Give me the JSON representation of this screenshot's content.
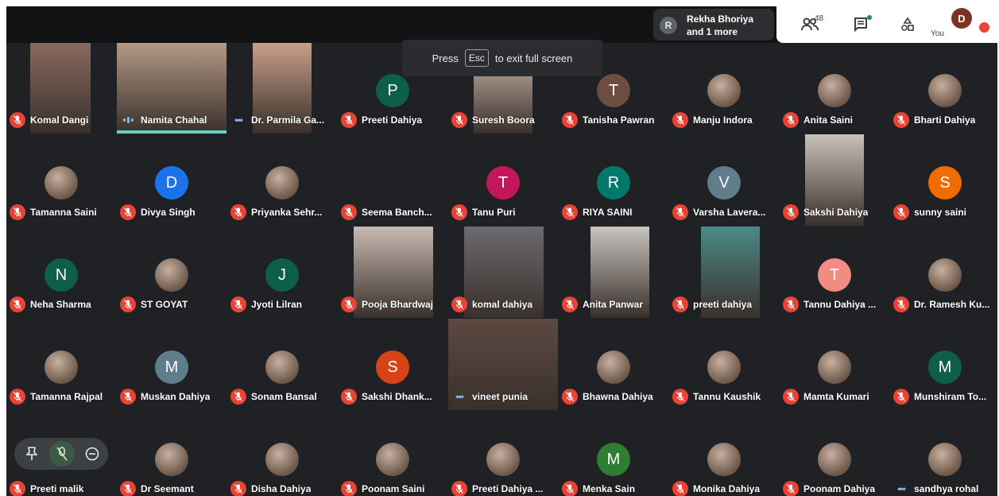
{
  "topbar": {
    "presenter": {
      "initial": "R",
      "line1": "Rekha Bhoriya",
      "line2": "and 1 more"
    },
    "participants_count": "48",
    "you_label": "You",
    "self_initial": "D"
  },
  "toast": {
    "press": "Press",
    "key": "Esc",
    "rest": "to exit full screen"
  },
  "colors": {
    "mute": "#ea4335",
    "speaking": "#66d0c4",
    "talking_icon": "#8ab4f8",
    "tile_bg": "#202124"
  },
  "participants": [
    {
      "name": "Komal Dangi",
      "status": "muted",
      "media": "video"
    },
    {
      "name": "Namita Chahal",
      "status": "talking",
      "media": "video"
    },
    {
      "name": "Dr. Parmila Ga...",
      "status": "dots",
      "media": "video"
    },
    {
      "name": "Preeti Dahiya",
      "status": "muted",
      "media": "avatar",
      "initial": "P",
      "color": "#0d5e4a"
    },
    {
      "name": "Suresh Boora",
      "status": "muted",
      "media": "video"
    },
    {
      "name": "Tanisha Pawran",
      "status": "muted",
      "media": "avatar",
      "initial": "T",
      "color": "#6d4c41"
    },
    {
      "name": "Manju Indora",
      "status": "muted",
      "media": "photo"
    },
    {
      "name": "Anita Saini",
      "status": "muted",
      "media": "photo"
    },
    {
      "name": "Bharti Dahiya",
      "status": "muted",
      "media": "photo"
    },
    {
      "name": "Tamanna Saini",
      "status": "muted",
      "media": "photo"
    },
    {
      "name": "Divya Singh",
      "status": "muted",
      "media": "avatar",
      "initial": "D",
      "color": "#1a73e8"
    },
    {
      "name": "Priyanka Sehr...",
      "status": "muted",
      "media": "photo"
    },
    {
      "name": "Seema Banch...",
      "status": "muted",
      "media": "none"
    },
    {
      "name": "Tanu Puri",
      "status": "muted",
      "media": "avatar",
      "initial": "T",
      "color": "#c2185b"
    },
    {
      "name": "RIYA SAINI",
      "status": "muted",
      "media": "avatar",
      "initial": "R",
      "color": "#00796b"
    },
    {
      "name": "Varsha Lavera...",
      "status": "muted",
      "media": "avatar",
      "initial": "V",
      "color": "#607d8b"
    },
    {
      "name": "Sakshi Dahiya",
      "status": "muted",
      "media": "video"
    },
    {
      "name": "sunny saini",
      "status": "muted",
      "media": "avatar",
      "initial": "S",
      "color": "#ef6c00"
    },
    {
      "name": "Neha Sharma",
      "status": "muted",
      "media": "avatar",
      "initial": "N",
      "color": "#0d5e4a"
    },
    {
      "name": "ST GOYAT",
      "status": "muted",
      "media": "photo"
    },
    {
      "name": "Jyoti Lilran",
      "status": "muted",
      "media": "avatar",
      "initial": "J",
      "color": "#0d5e4a"
    },
    {
      "name": "Pooja Bhardwaj",
      "status": "muted",
      "media": "video"
    },
    {
      "name": "komal dahiya",
      "status": "muted",
      "media": "video"
    },
    {
      "name": "Anita Panwar",
      "status": "muted",
      "media": "video"
    },
    {
      "name": "preeti dahiya",
      "status": "muted",
      "media": "video"
    },
    {
      "name": "Tannu Dahiya ...",
      "status": "muted",
      "media": "avatar",
      "initial": "T",
      "color": "#f28b82"
    },
    {
      "name": "Dr. Ramesh Ku...",
      "status": "muted",
      "media": "photo"
    },
    {
      "name": "Tamanna Rajpal",
      "status": "muted",
      "media": "photo"
    },
    {
      "name": "Muskan Dahiya",
      "status": "muted",
      "media": "avatar",
      "initial": "M",
      "color": "#607d8b"
    },
    {
      "name": "Sonam Bansal",
      "status": "muted",
      "media": "photo"
    },
    {
      "name": "Sakshi Dhank...",
      "status": "muted",
      "media": "avatar",
      "initial": "S",
      "color": "#d84315"
    },
    {
      "name": "vineet punia",
      "status": "dots",
      "media": "video"
    },
    {
      "name": "Bhawna Dahiya",
      "status": "muted",
      "media": "photo"
    },
    {
      "name": "Tannu Kaushik",
      "status": "muted",
      "media": "photo"
    },
    {
      "name": "Mamta Kumari",
      "status": "muted",
      "media": "photo"
    },
    {
      "name": "Munshiram To...",
      "status": "muted",
      "media": "avatar",
      "initial": "M",
      "color": "#0d5e4a"
    },
    {
      "name": "Preeti malik",
      "status": "muted",
      "media": "none"
    },
    {
      "name": "Dr Seemant",
      "status": "muted",
      "media": "photo"
    },
    {
      "name": "Disha Dahiya",
      "status": "muted",
      "media": "photo"
    },
    {
      "name": "Poonam Saini",
      "status": "muted",
      "media": "photo"
    },
    {
      "name": "Preeti Dahiya ...",
      "status": "muted",
      "media": "photo"
    },
    {
      "name": "Menka Sain",
      "status": "muted",
      "media": "avatar",
      "initial": "M",
      "color": "#2e7d32"
    },
    {
      "name": "Monika Dahiya",
      "status": "muted",
      "media": "photo"
    },
    {
      "name": "Poonam Dahiya",
      "status": "muted",
      "media": "photo"
    },
    {
      "name": "sandhya rohal",
      "status": "dots",
      "media": "photo"
    }
  ]
}
